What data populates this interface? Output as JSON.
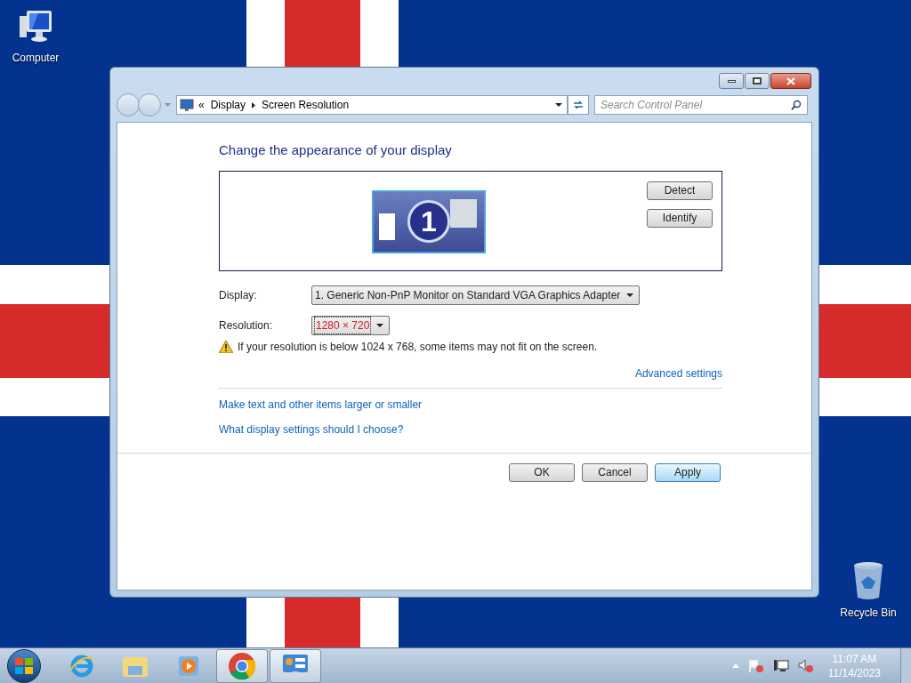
{
  "desktop_icons": [
    {
      "kind": "computer",
      "label": "Computer"
    },
    {
      "kind": "recycle",
      "label": "Recycle Bin"
    }
  ],
  "window": {
    "address": {
      "prefix": "«",
      "crumbs": [
        "Display",
        "Screen Resolution"
      ]
    },
    "search": {
      "placeholder": "Search Control Panel"
    },
    "heading": "Change the appearance of your display",
    "monitor": {
      "number": "1"
    },
    "side_buttons": [
      {
        "label": "Detect",
        "hovered": false
      },
      {
        "label": "Identify",
        "hovered": false
      }
    ],
    "fields": [
      {
        "label": "Display:",
        "value": "1. Generic Non-PnP Monitor on Standard VGA Graphics Adapter",
        "focused": false
      },
      {
        "label": "Resolution:",
        "value": "1280 × 720",
        "focused": true
      }
    ],
    "warning": "If your resolution is below 1024 x 768, some items may not fit on the screen.",
    "advanced_link": "Advanced settings",
    "links": [
      "Make text and other items larger or smaller",
      "What display settings should I choose?"
    ],
    "buttons": [
      {
        "label": "OK",
        "hovered": false
      },
      {
        "label": "Cancel",
        "hovered": false
      },
      {
        "label": "Apply",
        "hovered": true
      }
    ]
  },
  "taskbar": {
    "items": [
      {
        "kind": "ie",
        "running": false
      },
      {
        "kind": "explorer",
        "running": false
      },
      {
        "kind": "media",
        "running": false
      },
      {
        "kind": "chrome",
        "running": true
      },
      {
        "kind": "control",
        "running": true
      }
    ],
    "clock": {
      "time": "11:07 AM",
      "date": "11/14/2023"
    }
  }
}
